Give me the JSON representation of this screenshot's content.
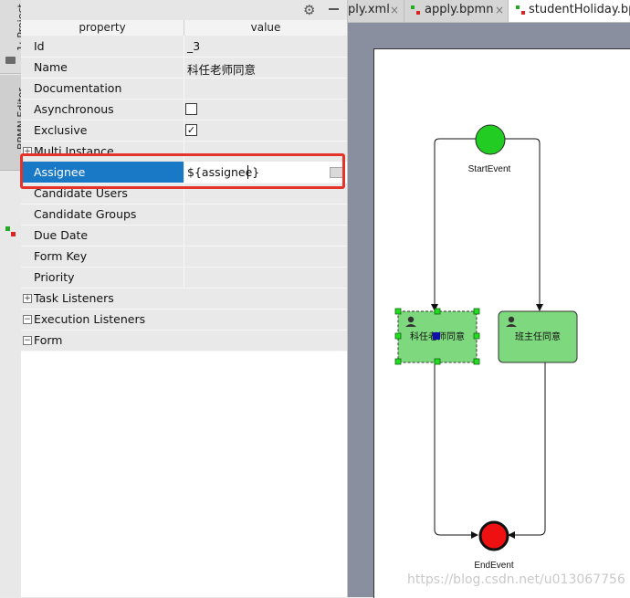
{
  "sidebar": {
    "project_tab": "1: Project",
    "bpmn_tab": "BPMN Editor"
  },
  "panel": {
    "toolbar": {
      "settings_icon": "gear-icon",
      "minimize_icon": "minus-icon"
    },
    "headers": {
      "property": "property",
      "value": "value"
    },
    "rows": [
      {
        "name": "Id",
        "value": "_3"
      },
      {
        "name": "Name",
        "value": "科任老师同意"
      },
      {
        "name": "Documentation",
        "value": ""
      },
      {
        "name": "Asynchronous",
        "checked": false
      },
      {
        "name": "Exclusive",
        "checked": true,
        "check_glyph": "✓"
      },
      {
        "name": "Multi Instance",
        "expander": "+"
      },
      {
        "name": "Assignee",
        "value": "${assignee}"
      },
      {
        "name": "Candidate Users",
        "value": ""
      },
      {
        "name": "Candidate Groups",
        "value": ""
      },
      {
        "name": "Due Date",
        "value": ""
      },
      {
        "name": "Form Key",
        "value": ""
      },
      {
        "name": "Priority",
        "value": ""
      },
      {
        "name": "Task Listeners",
        "expander": "+"
      },
      {
        "name": "Execution Listeners",
        "expander": "−"
      },
      {
        "name": "Form",
        "expander": "−"
      }
    ],
    "highlight_color": "#e4332a",
    "selection_color": "#1a79c6"
  },
  "tabs": [
    {
      "label": "ply.xml",
      "close": "×"
    },
    {
      "label": "apply.bpmn",
      "close": "×"
    },
    {
      "label": "studentHoliday.bpr"
    }
  ],
  "diagram": {
    "start_event": "StartEvent",
    "end_event": "EndEvent",
    "task1": "科任老师同意",
    "task2": "班主任同意",
    "start_color": "#22cc22",
    "end_color": "#ee1111",
    "task_color": "#7ed87e"
  },
  "watermark": "https://blog.csdn.net/u013067756"
}
